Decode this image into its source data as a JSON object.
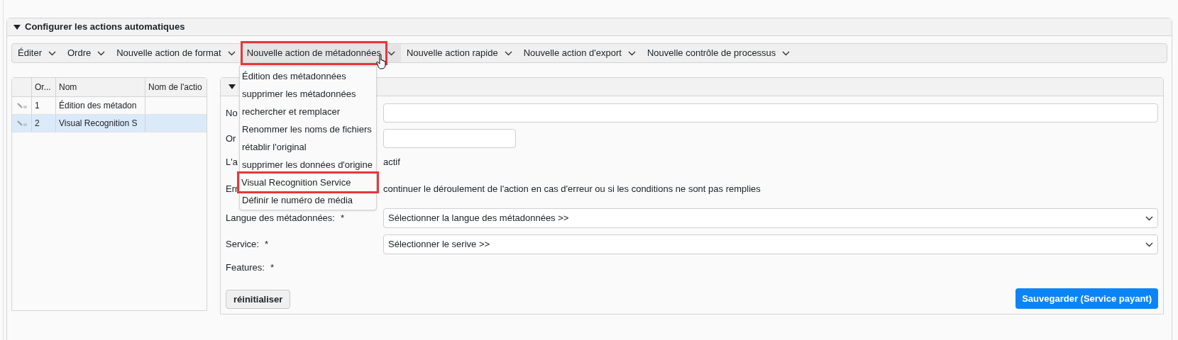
{
  "panel": {
    "title": "Configurer les actions automatiques",
    "expanded": true
  },
  "toolbar": [
    {
      "label": "Éditer",
      "open": false,
      "highlighted": false
    },
    {
      "label": "Ordre",
      "open": false,
      "highlighted": false
    },
    {
      "label": "Nouvelle action de format",
      "open": false,
      "highlighted": false
    },
    {
      "label": "Nouvelle action de métadonnées",
      "open": true,
      "highlighted": true
    },
    {
      "label": "Nouvelle action rapide",
      "open": false,
      "highlighted": false
    },
    {
      "label": "Nouvelle action d'export",
      "open": false,
      "highlighted": false
    },
    {
      "label": "Nouvelle contrôle de processus",
      "open": false,
      "highlighted": false
    }
  ],
  "menu": [
    {
      "label": "Édition des métadonnées",
      "highlighted": false
    },
    {
      "label": "supprimer les métadonnées",
      "highlighted": false
    },
    {
      "label": "rechercher et remplacer",
      "highlighted": false
    },
    {
      "label": "Renommer les noms de fichiers",
      "highlighted": false
    },
    {
      "label": "rétablir l'original",
      "highlighted": false
    },
    {
      "label": "supprimer les données d'origine",
      "highlighted": false
    },
    {
      "label": "Visual Recognition Service",
      "highlighted": true
    },
    {
      "label": "Définir le numéro de média",
      "highlighted": false
    }
  ],
  "table": {
    "columns": [
      "Or...",
      "Nom",
      "Nom de l'actio"
    ],
    "rows": [
      {
        "cells": [
          "1",
          "Édition des métadon",
          ""
        ],
        "selected": false
      },
      {
        "cells": [
          "2",
          "Visual Recognition S",
          ""
        ],
        "selected": true
      }
    ]
  },
  "form": {
    "expanded": true,
    "fields": [
      {
        "kind": "input",
        "label": "No"
      },
      {
        "kind": "short-input",
        "label": "Or"
      },
      {
        "kind": "text",
        "label": "L'a",
        "text": "actif"
      },
      {
        "kind": "text",
        "label": "Err",
        "text": "continuer le déroulement de l'action en cas d'erreur ou si les conditions ne sont pas remplies"
      },
      {
        "kind": "select",
        "label": "Langue des métadonnées:",
        "required": "*",
        "value": "Sélectionner la langue des métadonnées >>"
      },
      {
        "kind": "select",
        "label": "Service:",
        "required": "*",
        "value": "Sélectionner le serive >>"
      },
      {
        "kind": "empty",
        "label": "Features:",
        "required": "*"
      }
    ],
    "reset_button": "réinitialiser",
    "save_button": "Sauvegarder (Service payant)"
  }
}
